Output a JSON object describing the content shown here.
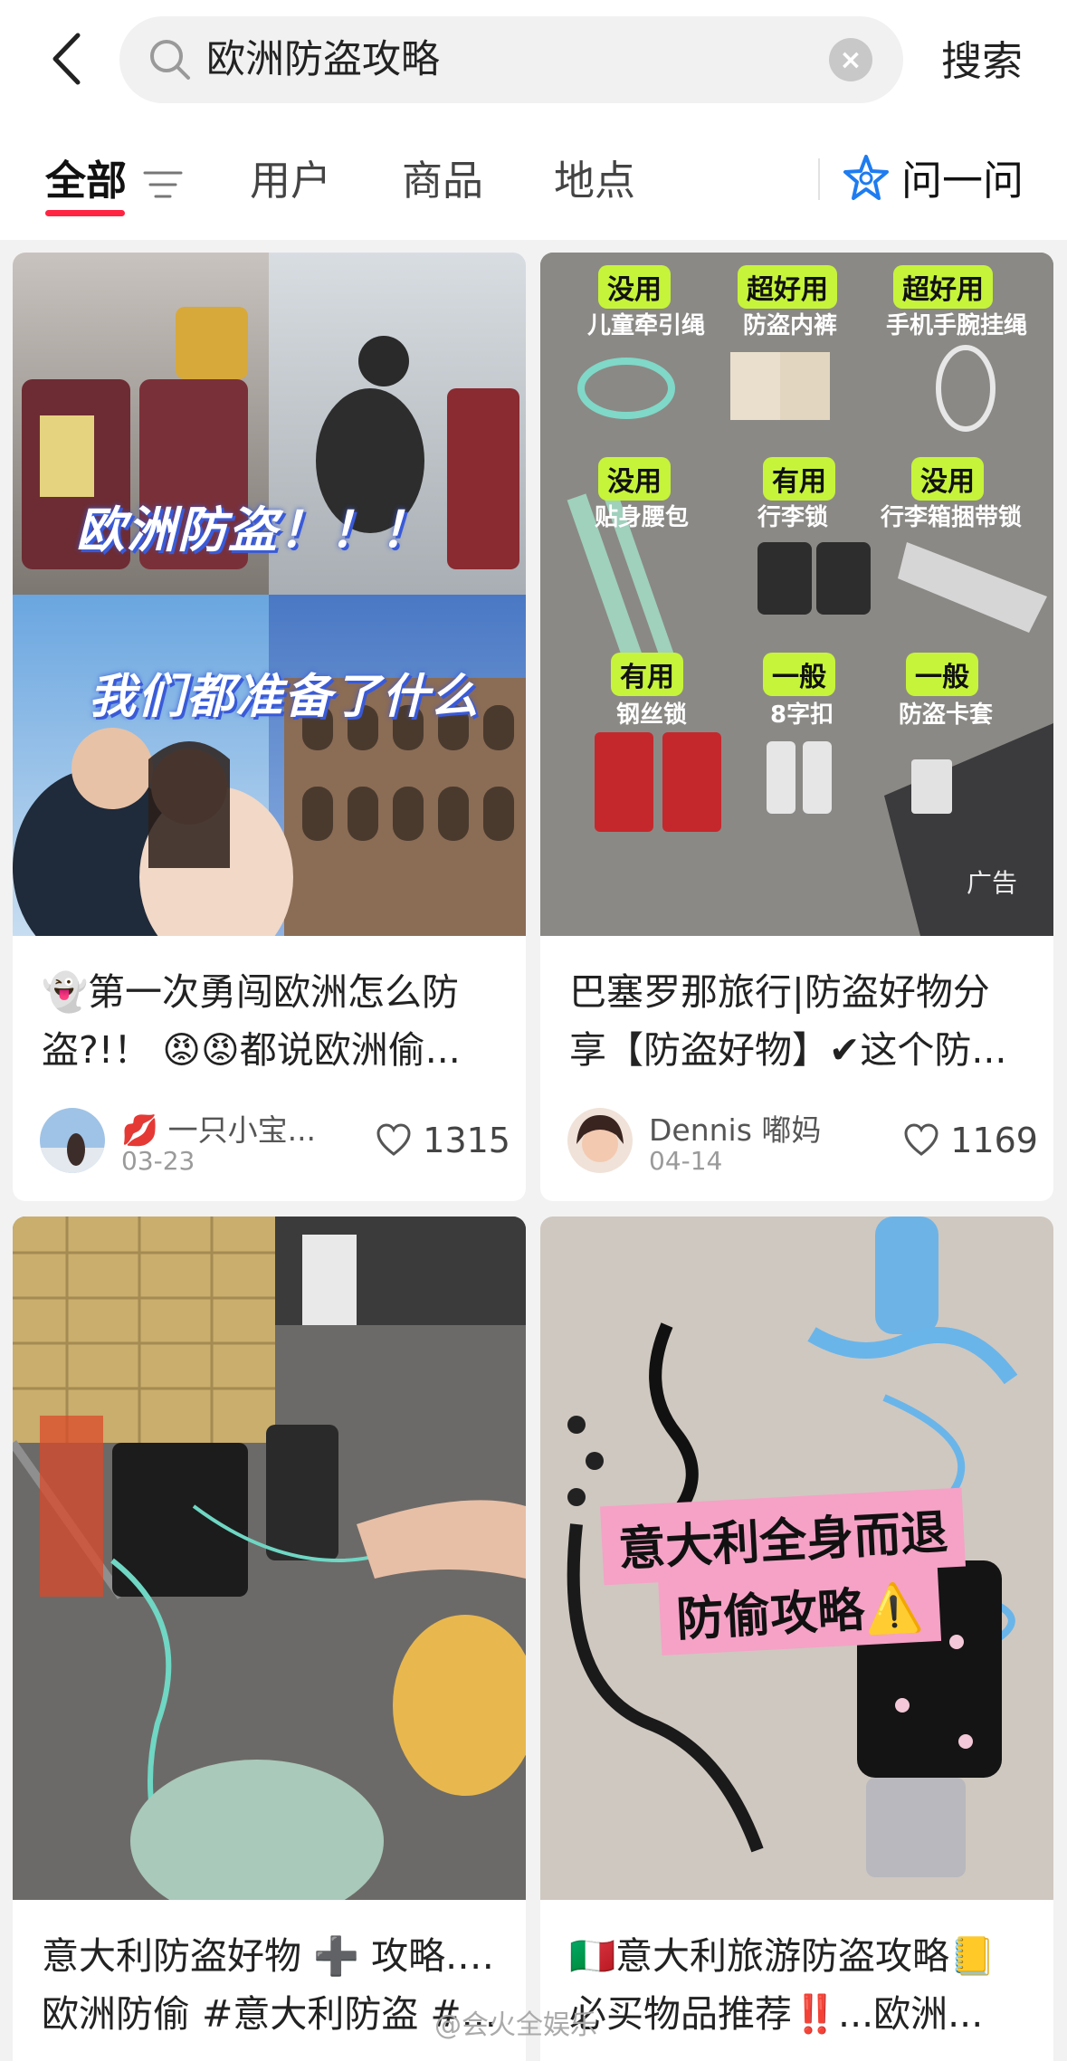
{
  "search": {
    "query": "欧洲防盗攻略",
    "clear_icon": "×",
    "submit_label": "搜索"
  },
  "tabs": [
    {
      "label": "全部",
      "active": true
    },
    {
      "label": "用户"
    },
    {
      "label": "商品"
    },
    {
      "label": "地点"
    }
  ],
  "ask": {
    "label": "问一问"
  },
  "colors": {
    "accent": "#ff2442",
    "ask_icon": "#1e7cf0",
    "label_green": "#c6f43a"
  },
  "cards": [
    {
      "image_text": [
        "欧洲防盗！！！",
        "我们都准备了什么"
      ],
      "title_line1": "👻第一次勇闯欧洲怎么防",
      "title_line2": "盗?!！ 😡😡都说欧洲偷...",
      "author": "💋 一只小宝...",
      "date": "03-23",
      "likes": "1315"
    },
    {
      "image_labels": [
        {
          "tag": "没用",
          "name": "儿童牵引绳"
        },
        {
          "tag": "超好用",
          "name": "防盗内裤"
        },
        {
          "tag": "超好用",
          "name": "手机手腕挂绳"
        },
        {
          "tag": "没用",
          "name": "贴身腰包"
        },
        {
          "tag": "有用",
          "name": "行李锁"
        },
        {
          "tag": "没用",
          "name": "行李箱捆带锁"
        },
        {
          "tag": "有用",
          "name": "钢丝锁"
        },
        {
          "tag": "一般",
          "name": "8字扣"
        },
        {
          "tag": "一般",
          "name": "防盗卡套"
        }
      ],
      "ad_badge": "广告",
      "title_line1": "巴塞罗那旅行|防盗好物分",
      "title_line2": "享【防盗好物】✔这个防...",
      "author": "Dennis 嘟妈",
      "date": "04-14",
      "likes": "1169"
    },
    {
      "title_line1": "意大利防盗好物 ➕ 攻略...#",
      "title_line2": "欧洲防偷 #意大利防盗 #..."
    },
    {
      "image_text": [
        "意大利全身而退",
        "防偷攻略⚠️"
      ],
      "title_line1": "🇮🇹意大利旅游防盗攻略📒",
      "title_line2": "必买物品推荐‼️...欧洲..."
    }
  ],
  "watermark": "@会火全娱乐"
}
